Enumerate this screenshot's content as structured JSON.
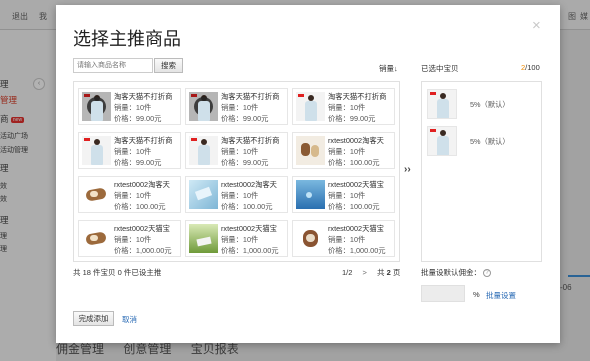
{
  "background": {
    "topbar": [
      "退出",
      "我",
      "图",
      "媒"
    ],
    "sidebar": [
      {
        "text": "理",
        "red": false
      },
      {
        "text": "管理",
        "red": true
      },
      {
        "text": "商",
        "red": false,
        "hot": "new"
      },
      {
        "text": "活动广场",
        "red": false
      },
      {
        "text": "活动管理",
        "red": false
      },
      {
        "text": "理",
        "red": false
      },
      {
        "text": "效",
        "red": false
      },
      {
        "text": "效",
        "red": false
      },
      {
        "text": "理",
        "red": false
      },
      {
        "text": "理",
        "red": false
      },
      {
        "text": "理",
        "red": false
      },
      {
        "text": "理",
        "red": false
      }
    ],
    "bottom_tabs": [
      "佣金管理",
      "创意管理",
      "宝贝报表"
    ],
    "date_fragment": "-06"
  },
  "modal": {
    "title": "选择主推商品",
    "close_icon": "×",
    "search_placeholder": "请输入商品名称",
    "search_button": "搜索",
    "sort_label": "销量↓",
    "products": [
      {
        "name": "淘客天猫不打折商",
        "sales": "销量：10件",
        "price": "价格：99.00元",
        "img": "dress",
        "selected": true
      },
      {
        "name": "淘客天猫不打折商",
        "sales": "销量：10件",
        "price": "价格：99.00元",
        "img": "dress",
        "selected": true
      },
      {
        "name": "淘客天猫不打折商",
        "sales": "销量：10件",
        "price": "价格：99.00元",
        "img": "dress",
        "selected": false
      },
      {
        "name": "淘客天猫不打折商",
        "sales": "销量：10件",
        "price": "价格：99.00元",
        "img": "dress",
        "selected": false
      },
      {
        "name": "淘客天猫不打折商",
        "sales": "销量：10件",
        "price": "价格：99.00元",
        "img": "dress",
        "selected": false
      },
      {
        "name": "rxtest0002淘客天",
        "sales": "销量：10件",
        "price": "价格：100.00元",
        "img": "bears",
        "selected": false
      },
      {
        "name": "rxtest0002淘客天",
        "sales": "销量：10件",
        "price": "价格：100.00元",
        "img": "ribbon",
        "selected": false
      },
      {
        "name": "rxtest0002淘客天",
        "sales": "销量：10件",
        "price": "价格：100.00元",
        "img": "bird",
        "selected": false
      },
      {
        "name": "rxtest0002天猫宝",
        "sales": "销量：10件",
        "price": "价格：100.00元",
        "img": "water",
        "selected": false
      },
      {
        "name": "rxtest0002天猫宝",
        "sales": "销量：10件",
        "price": "价格：1,000.00元",
        "img": "ribbon",
        "selected": false
      },
      {
        "name": "rxtest0002天猫宝",
        "sales": "销量：10件",
        "price": "价格：1,000.00元",
        "img": "green",
        "selected": false
      },
      {
        "name": "rxtest0002天猫宝",
        "sales": "销量：10件",
        "price": "价格：1,000.00元",
        "img": "dog",
        "selected": false
      }
    ],
    "total_text": "共 18 件宝贝   0 件已设主推",
    "pager": {
      "current": "1/2",
      "next": ">",
      "total_prefix": "共",
      "total_pages": "2",
      "total_suffix": "页"
    },
    "transfer_icon": "››",
    "selected_header": "已选中宝贝",
    "selected_count": "2",
    "selected_max": "/100",
    "selected_items": [
      {
        "img": "dress",
        "rate": "5%（默认）"
      },
      {
        "img": "dress",
        "rate": "5%（默认）"
      }
    ],
    "batch_label": "批量设默认佣金：",
    "help_icon": "?",
    "percent_sign": "%",
    "batch_link": "批量设置",
    "done_button": "完成添加",
    "cancel_link": "取消"
  }
}
